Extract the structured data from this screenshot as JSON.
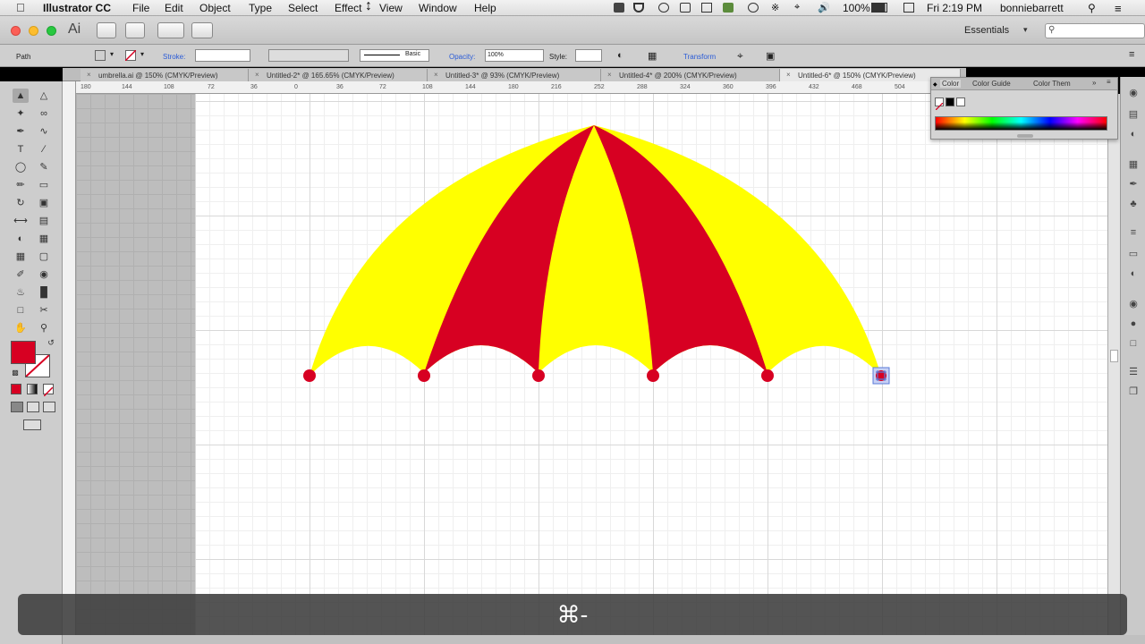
{
  "menubar": {
    "app_name": "Illustrator CC",
    "menus": [
      "File",
      "Edit",
      "Object",
      "Type",
      "Select",
      "Effect",
      "View",
      "Window",
      "Help"
    ],
    "battery": "100%",
    "clock": "Fri 2:19 PM",
    "user": "bonniebarrett"
  },
  "appbar": {
    "logo": "Ai",
    "workspace": "Essentials"
  },
  "control": {
    "selection_type": "Path",
    "fill_color": "#d70022",
    "stroke_label": "Stroke:",
    "brush_label": "Basic",
    "opacity_label": "Opacity:",
    "opacity_value": "100%",
    "style_label": "Style:",
    "transform_label": "Transform"
  },
  "tabs": [
    "umbrella.ai @ 150% (CMYK/Preview)",
    "Untitled-2* @ 165.65% (CMYK/Preview)",
    "Untitled-3* @ 93% (CMYK/Preview)",
    "Untitled-4* @ 200% (CMYK/Preview)",
    "Untitled-6* @ 150% (CMYK/Preview)"
  ],
  "ruler_ticks": [
    "180",
    "144",
    "108",
    "72",
    "36",
    "0",
    "36",
    "72",
    "108",
    "144",
    "180",
    "216",
    "252",
    "288",
    "324",
    "360",
    "396",
    "432",
    "468",
    "504"
  ],
  "color_panel": {
    "tabs": [
      "Color",
      "Color Guide",
      "Color Them"
    ]
  },
  "artwork": {
    "red": "#d70022",
    "yellow": "#ffff00",
    "selected_anchor_color": "#5a7bd9"
  },
  "osd": {
    "shortcut": "⌘-"
  }
}
